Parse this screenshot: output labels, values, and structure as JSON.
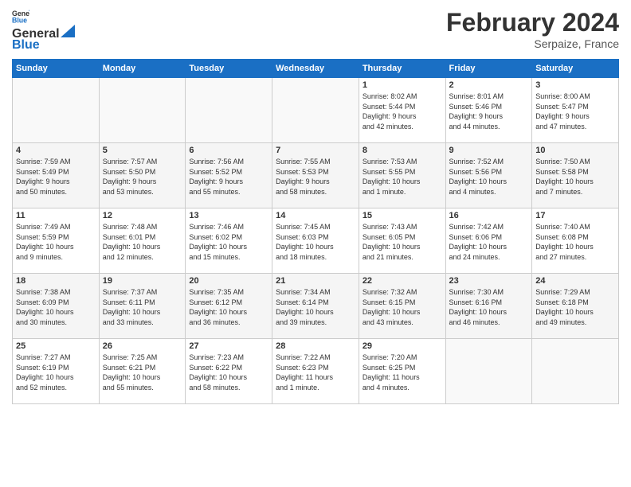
{
  "header": {
    "logo_line1": "General",
    "logo_line2": "Blue",
    "month": "February 2024",
    "location": "Serpaize, France"
  },
  "days_of_week": [
    "Sunday",
    "Monday",
    "Tuesday",
    "Wednesday",
    "Thursday",
    "Friday",
    "Saturday"
  ],
  "weeks": [
    [
      {
        "day": "",
        "content": ""
      },
      {
        "day": "",
        "content": ""
      },
      {
        "day": "",
        "content": ""
      },
      {
        "day": "",
        "content": ""
      },
      {
        "day": "1",
        "content": "Sunrise: 8:02 AM\nSunset: 5:44 PM\nDaylight: 9 hours\nand 42 minutes."
      },
      {
        "day": "2",
        "content": "Sunrise: 8:01 AM\nSunset: 5:46 PM\nDaylight: 9 hours\nand 44 minutes."
      },
      {
        "day": "3",
        "content": "Sunrise: 8:00 AM\nSunset: 5:47 PM\nDaylight: 9 hours\nand 47 minutes."
      }
    ],
    [
      {
        "day": "4",
        "content": "Sunrise: 7:59 AM\nSunset: 5:49 PM\nDaylight: 9 hours\nand 50 minutes."
      },
      {
        "day": "5",
        "content": "Sunrise: 7:57 AM\nSunset: 5:50 PM\nDaylight: 9 hours\nand 53 minutes."
      },
      {
        "day": "6",
        "content": "Sunrise: 7:56 AM\nSunset: 5:52 PM\nDaylight: 9 hours\nand 55 minutes."
      },
      {
        "day": "7",
        "content": "Sunrise: 7:55 AM\nSunset: 5:53 PM\nDaylight: 9 hours\nand 58 minutes."
      },
      {
        "day": "8",
        "content": "Sunrise: 7:53 AM\nSunset: 5:55 PM\nDaylight: 10 hours\nand 1 minute."
      },
      {
        "day": "9",
        "content": "Sunrise: 7:52 AM\nSunset: 5:56 PM\nDaylight: 10 hours\nand 4 minutes."
      },
      {
        "day": "10",
        "content": "Sunrise: 7:50 AM\nSunset: 5:58 PM\nDaylight: 10 hours\nand 7 minutes."
      }
    ],
    [
      {
        "day": "11",
        "content": "Sunrise: 7:49 AM\nSunset: 5:59 PM\nDaylight: 10 hours\nand 9 minutes."
      },
      {
        "day": "12",
        "content": "Sunrise: 7:48 AM\nSunset: 6:01 PM\nDaylight: 10 hours\nand 12 minutes."
      },
      {
        "day": "13",
        "content": "Sunrise: 7:46 AM\nSunset: 6:02 PM\nDaylight: 10 hours\nand 15 minutes."
      },
      {
        "day": "14",
        "content": "Sunrise: 7:45 AM\nSunset: 6:03 PM\nDaylight: 10 hours\nand 18 minutes."
      },
      {
        "day": "15",
        "content": "Sunrise: 7:43 AM\nSunset: 6:05 PM\nDaylight: 10 hours\nand 21 minutes."
      },
      {
        "day": "16",
        "content": "Sunrise: 7:42 AM\nSunset: 6:06 PM\nDaylight: 10 hours\nand 24 minutes."
      },
      {
        "day": "17",
        "content": "Sunrise: 7:40 AM\nSunset: 6:08 PM\nDaylight: 10 hours\nand 27 minutes."
      }
    ],
    [
      {
        "day": "18",
        "content": "Sunrise: 7:38 AM\nSunset: 6:09 PM\nDaylight: 10 hours\nand 30 minutes."
      },
      {
        "day": "19",
        "content": "Sunrise: 7:37 AM\nSunset: 6:11 PM\nDaylight: 10 hours\nand 33 minutes."
      },
      {
        "day": "20",
        "content": "Sunrise: 7:35 AM\nSunset: 6:12 PM\nDaylight: 10 hours\nand 36 minutes."
      },
      {
        "day": "21",
        "content": "Sunrise: 7:34 AM\nSunset: 6:14 PM\nDaylight: 10 hours\nand 39 minutes."
      },
      {
        "day": "22",
        "content": "Sunrise: 7:32 AM\nSunset: 6:15 PM\nDaylight: 10 hours\nand 43 minutes."
      },
      {
        "day": "23",
        "content": "Sunrise: 7:30 AM\nSunset: 6:16 PM\nDaylight: 10 hours\nand 46 minutes."
      },
      {
        "day": "24",
        "content": "Sunrise: 7:29 AM\nSunset: 6:18 PM\nDaylight: 10 hours\nand 49 minutes."
      }
    ],
    [
      {
        "day": "25",
        "content": "Sunrise: 7:27 AM\nSunset: 6:19 PM\nDaylight: 10 hours\nand 52 minutes."
      },
      {
        "day": "26",
        "content": "Sunrise: 7:25 AM\nSunset: 6:21 PM\nDaylight: 10 hours\nand 55 minutes."
      },
      {
        "day": "27",
        "content": "Sunrise: 7:23 AM\nSunset: 6:22 PM\nDaylight: 10 hours\nand 58 minutes."
      },
      {
        "day": "28",
        "content": "Sunrise: 7:22 AM\nSunset: 6:23 PM\nDaylight: 11 hours\nand 1 minute."
      },
      {
        "day": "29",
        "content": "Sunrise: 7:20 AM\nSunset: 6:25 PM\nDaylight: 11 hours\nand 4 minutes."
      },
      {
        "day": "",
        "content": ""
      },
      {
        "day": "",
        "content": ""
      }
    ]
  ]
}
